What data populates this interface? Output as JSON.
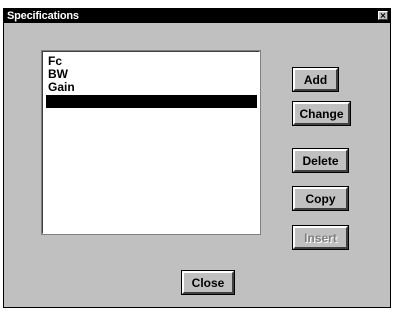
{
  "window": {
    "title": "Specifications"
  },
  "list": {
    "items": [
      "Fc",
      "BW",
      "Gain",
      ""
    ],
    "selected_index": 3
  },
  "buttons": {
    "add": "Add",
    "change": "Change",
    "delete": "Delete",
    "copy": "Copy",
    "insert": "Insert",
    "close": "Close"
  },
  "icons": {
    "window_close": "close-icon"
  }
}
